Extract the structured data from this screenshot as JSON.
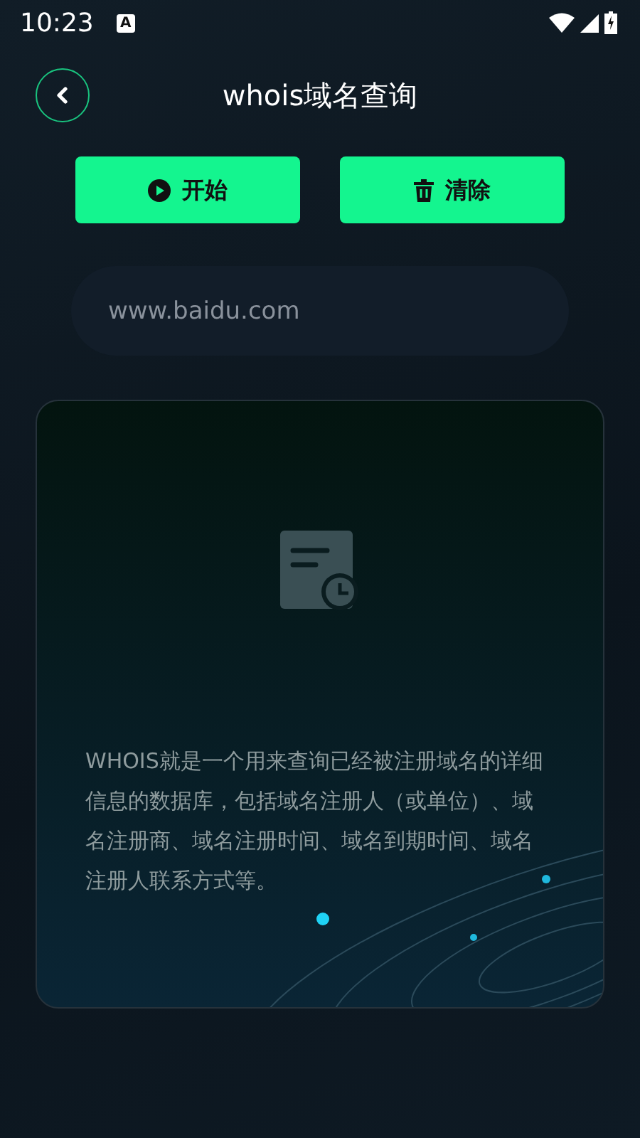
{
  "status_bar": {
    "time": "10:23",
    "notification": "A"
  },
  "header": {
    "title": "whois域名查询"
  },
  "buttons": [
    {
      "kind": "start",
      "label": "开始"
    },
    {
      "kind": "clear",
      "label": "清除"
    }
  ],
  "search": {
    "placeholder": "www.baidu.com"
  },
  "result": {
    "description": "WHOIS就是一个用来查询已经被注册域名的详细信息的数据库，包括域名注册人（或单位）、域名注册商、域名注册时间、域名到期时间、域名注册人联系方式等。"
  }
}
